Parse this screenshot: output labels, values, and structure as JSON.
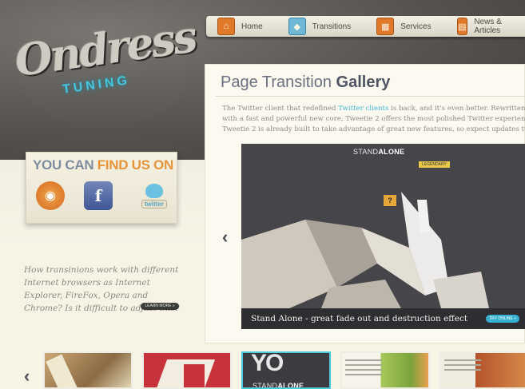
{
  "logo": {
    "script_text": "Ondress",
    "subtitle": "TUNING"
  },
  "nav": {
    "items": [
      {
        "label": "Home",
        "icon": "home-icon"
      },
      {
        "label": "Transitions",
        "icon": "diamond-icon"
      },
      {
        "label": "Services",
        "icon": "services-icon"
      },
      {
        "label": "News & Articles",
        "icon": "news-icon"
      }
    ]
  },
  "sidebar": {
    "find_us": {
      "title_part1": "YOU CAN ",
      "title_part2": "FIND US ON"
    },
    "social": [
      {
        "name": "rss",
        "icon": "rss-icon"
      },
      {
        "name": "facebook",
        "icon": "facebook-icon",
        "glyph": "f"
      },
      {
        "name": "twitter",
        "icon": "twitter-icon",
        "label": "twitter"
      }
    ],
    "question": "How transinions work with different Internet browsers as Internet Explorer, FireFox, Opera and Chrome? Is it difficult to adjust this?",
    "learn_more": "LEARN MORE »"
  },
  "main": {
    "title_plain": "Page Transition ",
    "title_bold": "Gallery",
    "intro_line1_a": "The Twitter client that redefined ",
    "intro_link": "Twitter clients",
    "intro_line1_b": " is back, and it's even better. Rewritten from the grou",
    "intro_line2": "with a fast and powerful new core, Tweetie 2 offers the most polished Twitter experience a",
    "intro_line3": "Tweetie 2 is already built to take advantage of great new features, so expect updates turning them o"
  },
  "slider": {
    "heading_plain": "STAND",
    "heading_bold": "ALONE",
    "tag": "LEGENDARY",
    "question_mark": "?",
    "caption": "Stand Alone - great fade out and destruction effect",
    "try_button": "TRY ONLINE »",
    "prev_glyph": "‹"
  },
  "thumbnails": {
    "prev_glyph": "‹",
    "items": [
      {
        "name": "thumb-1"
      },
      {
        "name": "thumb-2"
      },
      {
        "name": "thumb-3",
        "big_text": "YO",
        "label_plain": "STAND",
        "label_bold": "ALONE"
      },
      {
        "name": "thumb-4"
      },
      {
        "name": "thumb-5"
      }
    ]
  },
  "colors": {
    "accent_orange": "#e07a2a",
    "accent_cyan": "#3ab8d4",
    "background": "#f7f4e6",
    "dark_band": "#55524f"
  }
}
